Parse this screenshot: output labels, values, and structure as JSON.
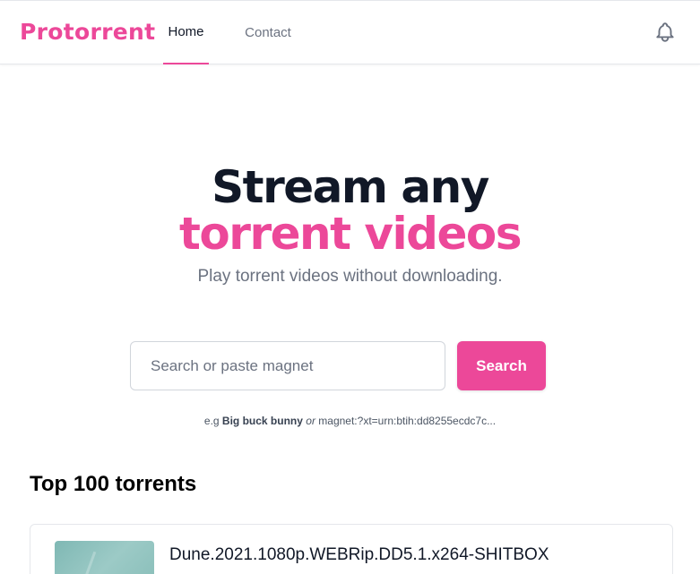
{
  "navbar": {
    "logo": "Protorrent",
    "links": [
      {
        "label": "Home",
        "active": true
      },
      {
        "label": "Contact",
        "active": false
      }
    ],
    "notification_icon": "bell-icon"
  },
  "hero": {
    "title_line1": "Stream any",
    "title_line2": "torrent videos",
    "subtitle": "Play torrent videos without downloading."
  },
  "search": {
    "placeholder": "Search or paste magnet",
    "value": "",
    "button_label": "Search"
  },
  "example": {
    "prefix": "e.g",
    "bold": "Big buck bunny",
    "or": "or",
    "magnet": "magnet:?xt=urn:btih:dd8255ecdc7c..."
  },
  "top_list": {
    "title": "Top 100 torrents",
    "items": [
      {
        "name": "Dune.2021.1080p.WEBRip.DD5.1.x264-SHITBOX"
      }
    ]
  },
  "colors": {
    "accent": "#ec4899",
    "heading": "#111827",
    "muted": "#6b7280"
  }
}
